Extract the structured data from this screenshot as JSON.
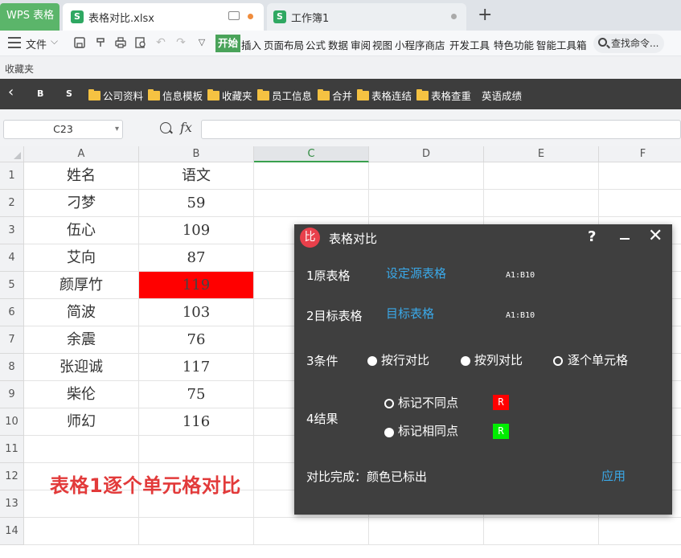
{
  "tabs": {
    "app_label": "WPS 表格",
    "file_tab": "表格对比.xlsx",
    "file_tab_icon": "S",
    "workbook_tab": "工作簿1",
    "workbook_tab_icon": "S",
    "new_tab": "+"
  },
  "menu": {
    "file": "文件",
    "file_chevron": "⌵",
    "start": "开始",
    "items": [
      "插入",
      "页面布局",
      "公式",
      "数据",
      "审阅",
      "视图",
      "小程序商店",
      "开发工具",
      "特色功能",
      "智能工具箱"
    ],
    "search": "查找命令..."
  },
  "favorites": {
    "label": "收藏夹"
  },
  "bookmarks": {
    "back": "‹",
    "b_label": "B",
    "s_label": "S",
    "folders": [
      "公司资料",
      "信息模板",
      "收藏夹",
      "员工信息",
      "合并",
      "表格连结",
      "表格查重"
    ],
    "plain": "英语成绩"
  },
  "formula_bar": {
    "cell_ref": "C23",
    "fx": "fx",
    "value": ""
  },
  "sheet": {
    "columns": [
      "A",
      "B",
      "C",
      "D",
      "E",
      "F"
    ],
    "active_column": "C",
    "rows": [
      "1",
      "2",
      "3",
      "4",
      "5",
      "6",
      "7",
      "8",
      "9",
      "10",
      "11",
      "12",
      "13",
      "14"
    ],
    "data": [
      [
        "姓名",
        "语文"
      ],
      [
        "刁梦",
        "59"
      ],
      [
        "伍心",
        "109"
      ],
      [
        "艾向",
        "87"
      ],
      [
        "颜厚竹",
        "119"
      ],
      [
        "简波",
        "103"
      ],
      [
        "余震",
        "76"
      ],
      [
        "张迎诚",
        "117"
      ],
      [
        "柴伦",
        "75"
      ],
      [
        "师幻",
        "116"
      ]
    ],
    "highlight_color": "#ff0000",
    "annotation": "表格1逐个单元格对比"
  },
  "dialog": {
    "logo": "比",
    "title": "表格对比",
    "help": "?",
    "close": "✕",
    "source_label": "1原表格",
    "source_link": "设定源表格",
    "source_range": "A1:B10",
    "target_label": "2目标表格",
    "target_link": "目标表格",
    "target_range": "A1:B10",
    "condition_label": "3条件",
    "condition_by_row": "按行对比",
    "condition_by_col": "按列对比",
    "condition_by_cell": "逐个单元格",
    "result_label": "4结果",
    "result_mark_diff": "标记不同点",
    "result_mark_diff_swatch": "R",
    "result_mark_diff_color": "#ff0000",
    "result_mark_same": "标记相同点",
    "result_mark_same_swatch": "R",
    "result_mark_same_color": "#00ee00",
    "status": "对比完成：颜色已标出",
    "apply": "应用"
  }
}
